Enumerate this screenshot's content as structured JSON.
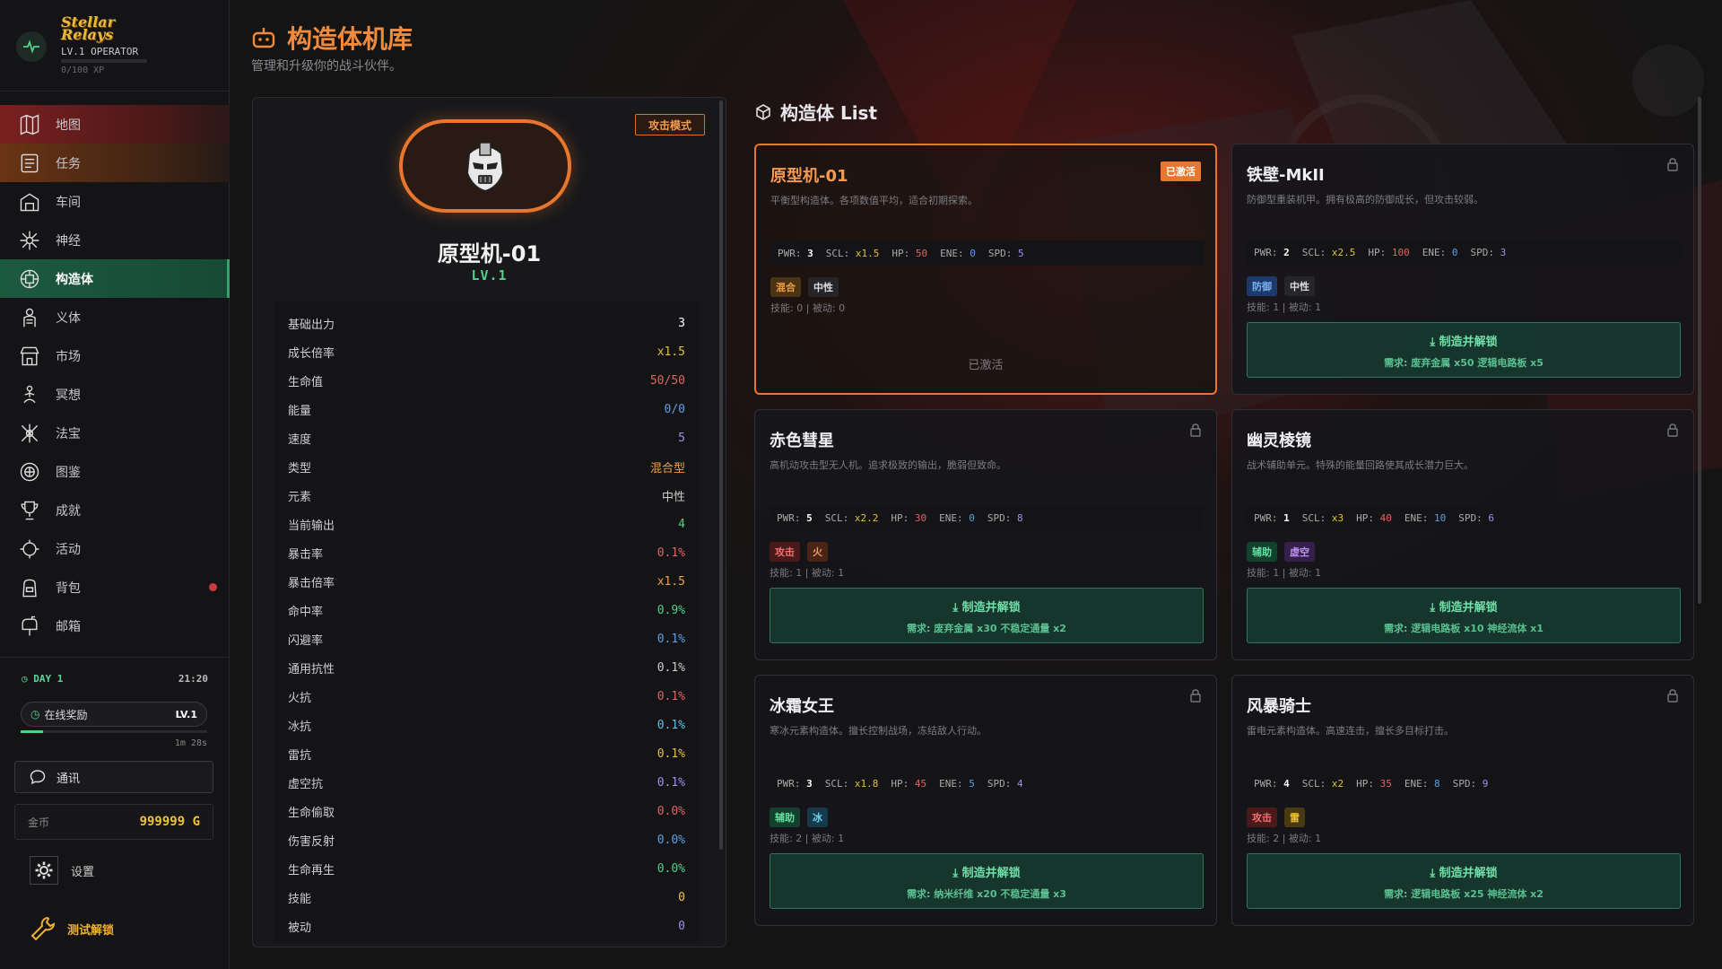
{
  "app": {
    "logo_line1": "Stellar",
    "logo_line2": "Relays",
    "level": "LV.1 OPERATOR",
    "xp": "0/100 XP"
  },
  "nav": [
    {
      "label": "地图",
      "icon": "map-icon",
      "style": "red"
    },
    {
      "label": "任务",
      "icon": "quest-scroll-icon",
      "style": "orange"
    },
    {
      "label": "车间",
      "icon": "workshop-icon",
      "style": ""
    },
    {
      "label": "神经",
      "icon": "neural-icon",
      "style": ""
    },
    {
      "label": "构造体",
      "icon": "construct-icon",
      "style": "green"
    },
    {
      "label": "义体",
      "icon": "cyborg-body-icon",
      "style": ""
    },
    {
      "label": "市场",
      "icon": "market-icon",
      "style": ""
    },
    {
      "label": "冥想",
      "icon": "meditation-icon",
      "style": ""
    },
    {
      "label": "法宝",
      "icon": "artifact-icon",
      "style": ""
    },
    {
      "label": "图鉴",
      "icon": "codex-icon",
      "style": ""
    },
    {
      "label": "成就",
      "icon": "trophy-icon",
      "style": ""
    },
    {
      "label": "活动",
      "icon": "event-icon",
      "style": ""
    },
    {
      "label": "背包",
      "icon": "backpack-icon",
      "style": "",
      "dot": true
    },
    {
      "label": "邮箱",
      "icon": "mailbox-icon",
      "style": ""
    }
  ],
  "status": {
    "day": "DAY 1",
    "time": "21:20",
    "online_reward": "在线奖励",
    "reward_level": "LV.1",
    "reward_timer": "1m 28s",
    "reward_progress": 0.12,
    "comm": "通讯",
    "gold_label": "金币",
    "gold_value": "999999 G",
    "settings": "设置",
    "test_unlock": "测试解锁"
  },
  "header": {
    "title": "构造体机库",
    "subtitle": "管理和升级你的战斗伙伴。"
  },
  "current": {
    "mode": "攻击模式",
    "name": "原型机-01",
    "level": "LV.1",
    "stats": [
      {
        "label": "基础出力",
        "value": "3",
        "color": "#ffffff"
      },
      {
        "label": "成长倍率",
        "value": "x1.5",
        "color": "#e0c040"
      },
      {
        "label": "生命值",
        "value": "50/50",
        "color": "#e06464"
      },
      {
        "label": "能量",
        "value": "0/0",
        "color": "#5a9ee8"
      },
      {
        "label": "速度",
        "value": "5",
        "color": "#a48cf0"
      },
      {
        "label": "类型",
        "value": "混合型",
        "color": "#f0a040"
      },
      {
        "label": "元素",
        "value": "中性",
        "color": "#cccccc"
      },
      {
        "label": "当前输出",
        "value": "4",
        "color": "#4fd18a"
      },
      {
        "label": "暴击率",
        "value": "0.1%",
        "color": "#e06464"
      },
      {
        "label": "暴击倍率",
        "value": "x1.5",
        "color": "#f0a040"
      },
      {
        "label": "命中率",
        "value": "0.9%",
        "color": "#4fd18a"
      },
      {
        "label": "闪避率",
        "value": "0.1%",
        "color": "#5aa0e8"
      },
      {
        "label": "通用抗性",
        "value": "0.1%",
        "color": "#cccccc"
      },
      {
        "label": "火抗",
        "value": "0.1%",
        "color": "#e06464"
      },
      {
        "label": "冰抗",
        "value": "0.1%",
        "color": "#5ac0e8"
      },
      {
        "label": "雷抗",
        "value": "0.1%",
        "color": "#e0c040"
      },
      {
        "label": "虚空抗",
        "value": "0.1%",
        "color": "#a48cf0"
      },
      {
        "label": "生命偷取",
        "value": "0.0%",
        "color": "#e06464"
      },
      {
        "label": "伤害反射",
        "value": "0.0%",
        "color": "#5aa0e8"
      },
      {
        "label": "生命再生",
        "value": "0.0%",
        "color": "#4fd18a"
      },
      {
        "label": "技能",
        "value": "0",
        "color": "#f0c040"
      },
      {
        "label": "被动",
        "value": "0",
        "color": "#a48cf0"
      }
    ]
  },
  "list": {
    "title": "构造体 List",
    "cards": [
      {
        "name": "原型机-01",
        "desc": "平衡型构造体。各项数值平均，适合初期探索。",
        "active": true,
        "badge": "已激活",
        "pwr": "3",
        "scl": "x1.5",
        "hp": "50",
        "ene": "0",
        "spd": "5",
        "tags": [
          {
            "text": "混合",
            "bg": "#4a3414",
            "fg": "#f0a040"
          },
          {
            "text": "中性",
            "bg": "#26262a",
            "fg": "#dddddd"
          }
        ],
        "skills": "技能: 0 | 被动: 0",
        "status": "已激活"
      },
      {
        "name": "铁壁-MkII",
        "desc": "防御型重装机甲。拥有极高的防御成长，但攻击较弱。",
        "pwr": "2",
        "scl": "x2.5",
        "hp": "100",
        "ene": "0",
        "spd": "3",
        "tags": [
          {
            "text": "防御",
            "bg": "#1e3a6a",
            "fg": "#7ab0f0"
          },
          {
            "text": "中性",
            "bg": "#26262a",
            "fg": "#dddddd"
          }
        ],
        "skills": "技能: 1 | 被动: 1",
        "craft": "制造并解锁",
        "req": "需求: 废弃金属 x50  逻辑电路板 x5"
      },
      {
        "name": "赤色彗星",
        "desc": "高机动攻击型无人机。追求极致的输出，脆弱但致命。",
        "pwr": "5",
        "scl": "x2.2",
        "hp": "30",
        "ene": "0",
        "spd": "8",
        "tags": [
          {
            "text": "攻击",
            "bg": "#4a1a1a",
            "fg": "#f07070"
          },
          {
            "text": "火",
            "bg": "#4a2414",
            "fg": "#f0a060"
          }
        ],
        "skills": "技能: 1 | 被动: 1",
        "craft": "制造并解锁",
        "req": "需求: 废弃金属 x30  不稳定通量 x2"
      },
      {
        "name": "幽灵棱镜",
        "desc": "战术辅助单元。特殊的能量回路使其成长潜力巨大。",
        "pwr": "1",
        "scl": "x3",
        "hp": "40",
        "ene": "10",
        "spd": "6",
        "tags": [
          {
            "text": "辅助",
            "bg": "#14402e",
            "fg": "#60e0a0"
          },
          {
            "text": "虚空",
            "bg": "#34204a",
            "fg": "#c090f0"
          }
        ],
        "skills": "技能: 1 | 被动: 1",
        "craft": "制造并解锁",
        "req": "需求: 逻辑电路板 x10  神经流体 x1"
      },
      {
        "name": "冰霜女王",
        "desc": "寒冰元素构造体。擅长控制战场，冻结敌人行动。",
        "pwr": "3",
        "scl": "x1.8",
        "hp": "45",
        "ene": "5",
        "spd": "4",
        "tags": [
          {
            "text": "辅助",
            "bg": "#14402e",
            "fg": "#60e0a0"
          },
          {
            "text": "冰",
            "bg": "#163a4a",
            "fg": "#70d0f0"
          }
        ],
        "skills": "技能: 2 | 被动: 1",
        "craft": "制造并解锁",
        "req": "需求: 纳米纤维 x20  不稳定通量 x3"
      },
      {
        "name": "风暴骑士",
        "desc": "雷电元素构造体。高速连击，擅长多目标打击。",
        "pwr": "4",
        "scl": "x2",
        "hp": "35",
        "ene": "8",
        "spd": "9",
        "tags": [
          {
            "text": "攻击",
            "bg": "#4a1a1a",
            "fg": "#f07070"
          },
          {
            "text": "雷",
            "bg": "#4a3a14",
            "fg": "#f0c040"
          }
        ],
        "skills": "技能: 2 | 被动: 1",
        "craft": "制造并解锁",
        "req": "需求: 逻辑电路板 x25  神经流体 x2"
      }
    ]
  }
}
